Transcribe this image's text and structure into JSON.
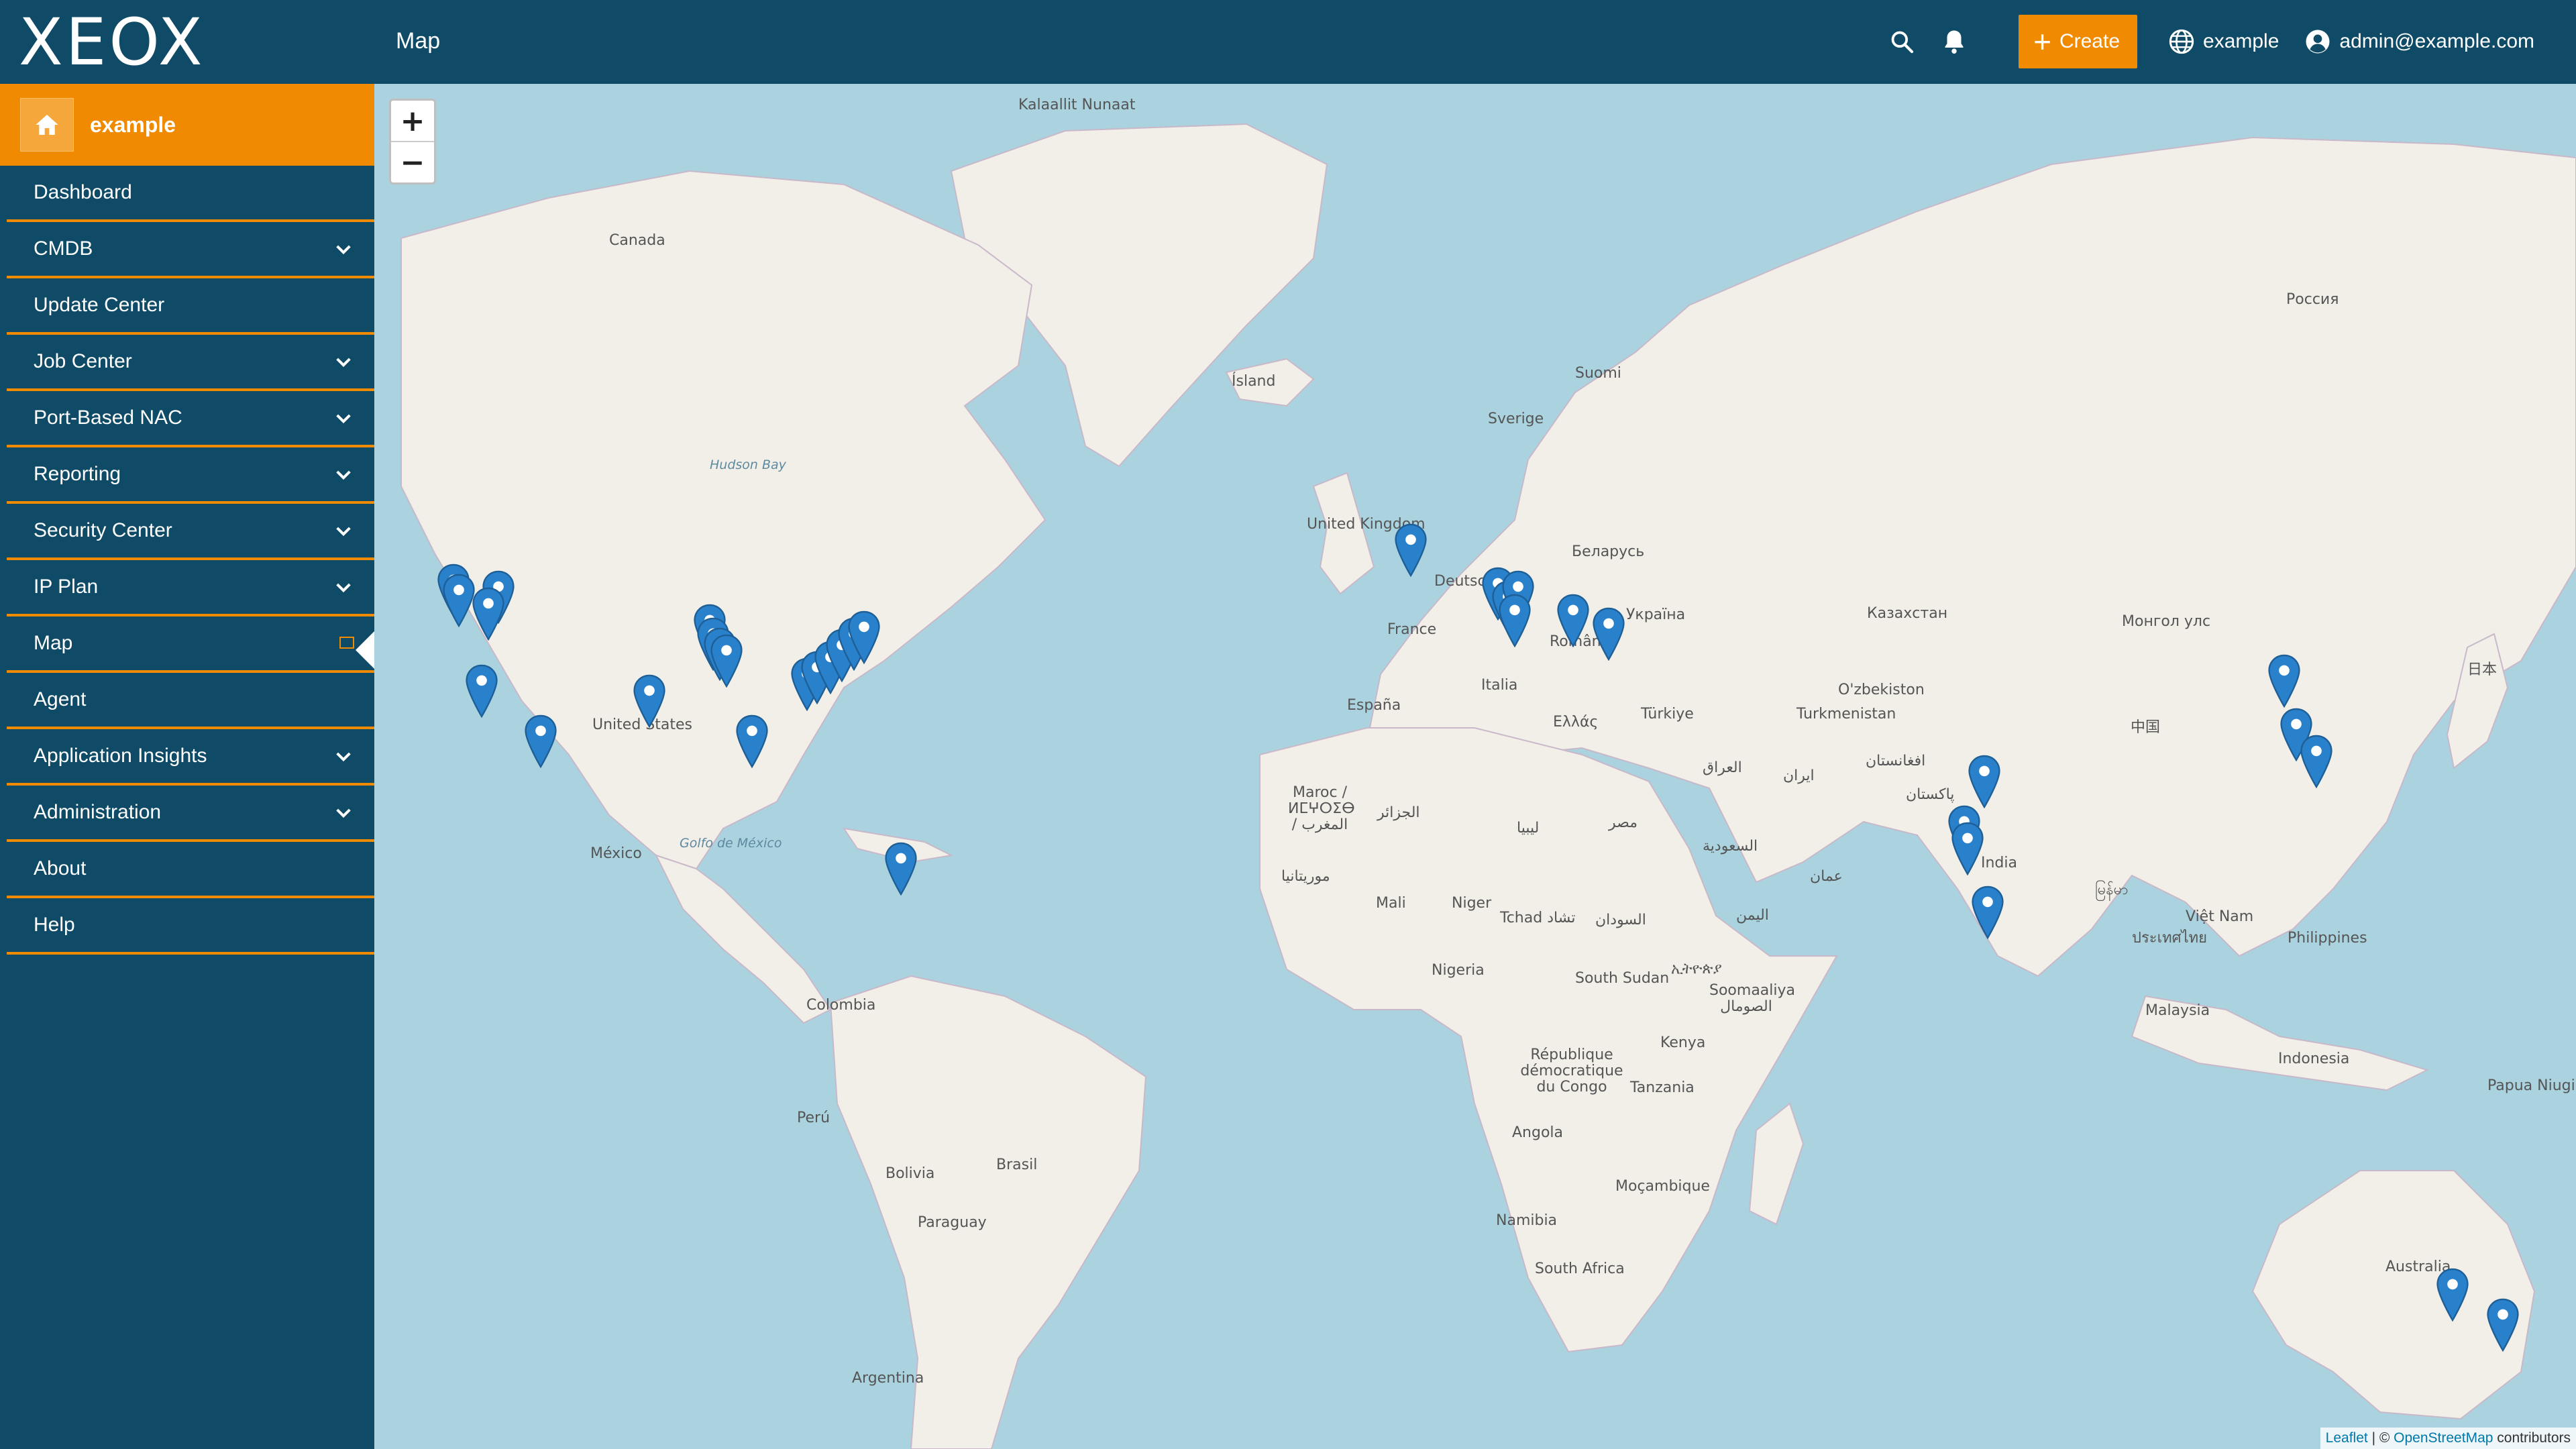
{
  "app": {
    "logo": "XEOX",
    "page_title": "Map"
  },
  "topbar": {
    "create_label": "Create",
    "tenant_label": "example",
    "user_label": "admin@example.com"
  },
  "sidebar": {
    "tenant": "example",
    "items": [
      {
        "label": "Dashboard",
        "expandable": false
      },
      {
        "label": "CMDB",
        "expandable": true
      },
      {
        "label": "Update Center",
        "expandable": false
      },
      {
        "label": "Job Center",
        "expandable": true
      },
      {
        "label": "Port-Based NAC",
        "expandable": true
      },
      {
        "label": "Reporting",
        "expandable": true
      },
      {
        "label": "Security Center",
        "expandable": true
      },
      {
        "label": "IP Plan",
        "expandable": true
      },
      {
        "label": "Map",
        "expandable": false,
        "active": true
      },
      {
        "label": "Agent",
        "expandable": false
      },
      {
        "label": "Application Insights",
        "expandable": true
      },
      {
        "label": "Administration",
        "expandable": true
      },
      {
        "label": "About",
        "expandable": false
      },
      {
        "label": "Help",
        "expandable": false
      }
    ]
  },
  "map": {
    "zoom_in": "+",
    "zoom_out": "−",
    "places": [
      "Kalaallit Nunaat",
      "Canada",
      "Hudson Bay",
      "United States",
      "México",
      "Golfo de México",
      "Ísland",
      "Suomi",
      "Sverige",
      "United Kingdom",
      "Deutschland",
      "France",
      "España",
      "Italia",
      "Беларусь",
      "Україна",
      "România",
      "Ελλάς",
      "Türkiye",
      "Россия",
      "Казахстан",
      "O'zbekiston",
      "Turkmenistan",
      "Монгол улс",
      "中国",
      "日本",
      "India",
      "پاکستان",
      "افغانستان",
      "ایران",
      "العراق",
      "السعودية",
      "مصر",
      "ليبيا",
      "Maroc / ⵍⵎⵖⵔⵉⴱ / المغرب",
      "الجزائر",
      "موريتانيا",
      "Mali",
      "Niger",
      "Tchad تشاد",
      "السودان",
      "Nigeria",
      "South Sudan",
      "ኢትዮጵያ",
      "Soomaaliya الصومال",
      "Kenya",
      "République démocratique du Congo",
      "Tanzania",
      "Angola",
      "Namibia",
      "Moçambique",
      "South Africa",
      "عمان",
      "اليمن",
      "Việt Nam",
      "ประเทศไทย",
      "Philippines",
      "Malaysia",
      "Indonesia",
      "Papua Niugini",
      "Australia",
      "Colombia",
      "Perú",
      "Brasil",
      "Bolivia",
      "Paraguay",
      "Argentina",
      "မြန်မာ"
    ],
    "attribution": {
      "leaflet": "Leaflet",
      "sep": " | © ",
      "osm": "OpenStreetMap",
      "suffix": " contributors"
    }
  },
  "colors": {
    "brand": "#0f4b66",
    "accent": "#f08a00",
    "water": "#aad3df",
    "land": "#f2efe9",
    "pin": "#2a81cb"
  }
}
